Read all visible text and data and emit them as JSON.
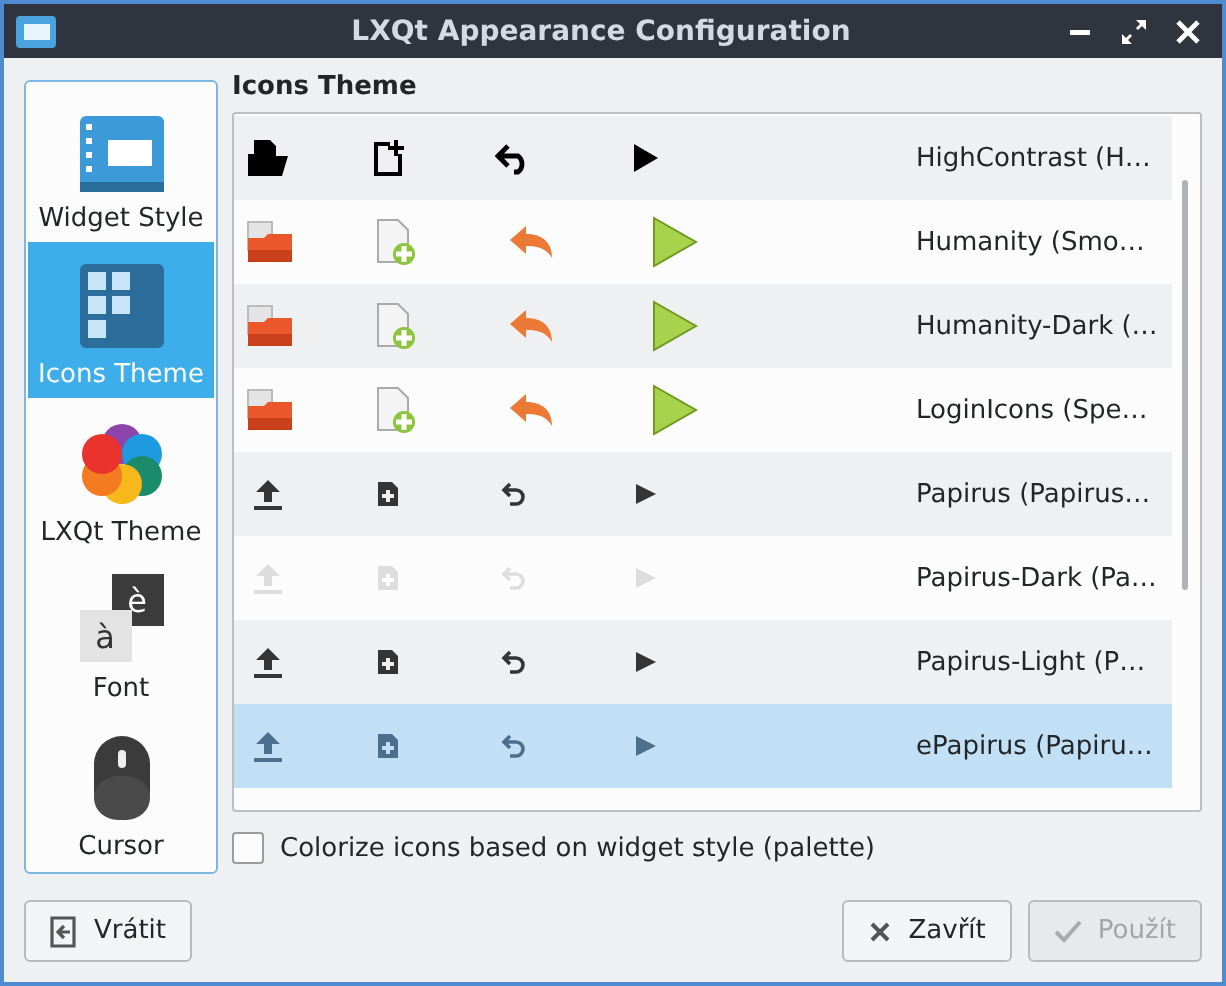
{
  "window": {
    "title": "LXQt Appearance Configuration"
  },
  "sidebar": {
    "items": [
      {
        "label": "Widget Style",
        "kind": "widget",
        "selected": false
      },
      {
        "label": "Icons Theme",
        "kind": "icons",
        "selected": true
      },
      {
        "label": "LXQt Theme",
        "kind": "theme",
        "selected": false
      },
      {
        "label": "Font",
        "kind": "font",
        "selected": false,
        "letters": [
          "è",
          "à"
        ]
      },
      {
        "label": "Cursor",
        "kind": "cursor",
        "selected": false
      }
    ]
  },
  "panel": {
    "title": "Icons Theme",
    "themes": [
      {
        "name": "HighContrast (H…",
        "kind": "contrast",
        "selected": false,
        "disabled": false
      },
      {
        "name": "Humanity (Smo…",
        "kind": "humanity",
        "selected": false,
        "disabled": false
      },
      {
        "name": "Humanity-Dark (…",
        "kind": "humanity",
        "selected": false,
        "disabled": false
      },
      {
        "name": "LoginIcons (Spe…",
        "kind": "humanity",
        "selected": false,
        "disabled": false
      },
      {
        "name": "Papirus (Papirus…",
        "kind": "papirus",
        "selected": false,
        "disabled": false
      },
      {
        "name": "Papirus-Dark (Pa…",
        "kind": "papirus",
        "selected": false,
        "disabled": true
      },
      {
        "name": "Papirus-Light (P…",
        "kind": "papirus",
        "selected": false,
        "disabled": false
      },
      {
        "name": "ePapirus (Papiru…",
        "kind": "papirus",
        "selected": true,
        "disabled": false
      }
    ],
    "checkbox": {
      "label": "Colorize icons based on widget style (palette)",
      "checked": false
    }
  },
  "buttons": [
    {
      "label": "Vrátit",
      "kind": "reset",
      "disabled": false
    },
    {
      "label": "Zavřít",
      "kind": "close",
      "disabled": false
    },
    {
      "label": "Použít",
      "kind": "apply",
      "disabled": true
    }
  ]
}
